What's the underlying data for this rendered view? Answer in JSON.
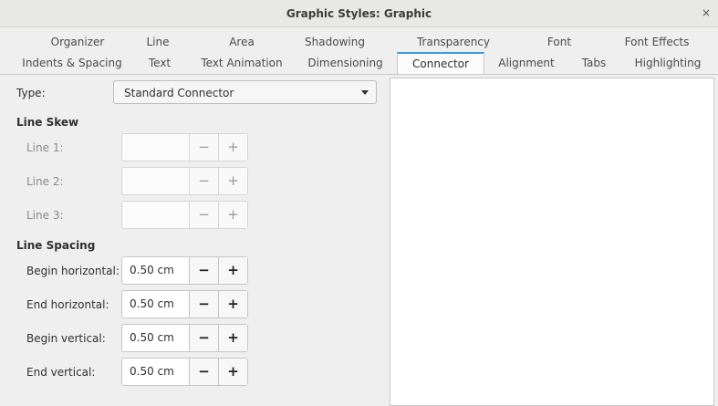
{
  "window": {
    "title": "Graphic Styles: Graphic",
    "close_glyph": "×"
  },
  "tabs_row1": [
    "Organizer",
    "Line",
    "Area",
    "Shadowing",
    "Transparency",
    "Font",
    "Font Effects"
  ],
  "tabs_row2": [
    "Indents & Spacing",
    "Text",
    "Text Animation",
    "Dimensioning",
    "Connector",
    "Alignment",
    "Tabs",
    "Highlighting"
  ],
  "active_tab": "Connector",
  "type": {
    "label": "Type:",
    "value": "Standard Connector"
  },
  "line_skew": {
    "heading": "Line Skew",
    "rows": [
      {
        "label": "Line 1:",
        "value": ""
      },
      {
        "label": "Line 2:",
        "value": ""
      },
      {
        "label": "Line 3:",
        "value": ""
      }
    ]
  },
  "line_spacing": {
    "heading": "Line Spacing",
    "rows": [
      {
        "label": "Begin horizontal:",
        "value": "0.50 cm"
      },
      {
        "label": "End horizontal:",
        "value": "0.50 cm"
      },
      {
        "label": "Begin vertical:",
        "value": "0.50 cm"
      },
      {
        "label": "End vertical:",
        "value": "0.50 cm"
      }
    ]
  },
  "spin": {
    "minus": "−",
    "plus": "+"
  },
  "colors": {
    "accent": "#3a9be0",
    "window_bg": "#efefef"
  }
}
